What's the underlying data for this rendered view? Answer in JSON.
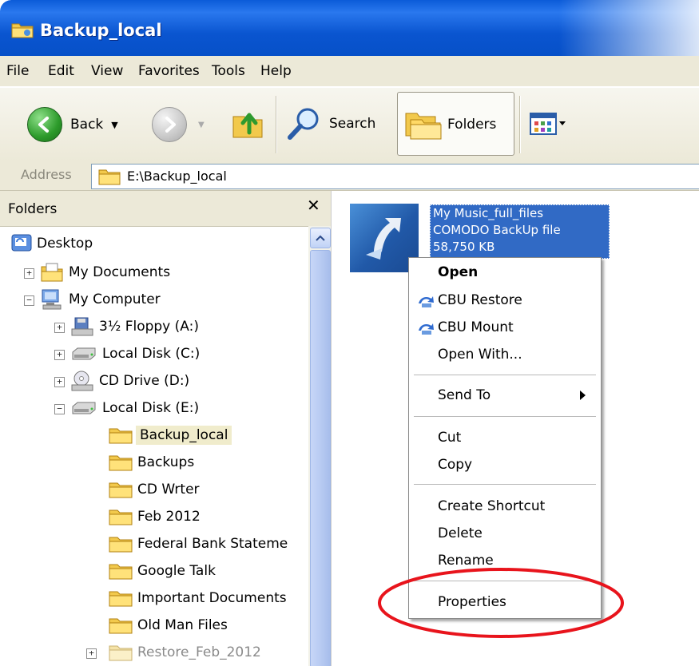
{
  "window": {
    "title": "Backup_local"
  },
  "menubar": {
    "items": [
      "File",
      "Edit",
      "View",
      "Favorites",
      "Tools",
      "Help"
    ]
  },
  "toolbar": {
    "back_label": "Back",
    "search_label": "Search",
    "folders_label": "Folders"
  },
  "address": {
    "label": "Address",
    "value": "E:\\Backup_local"
  },
  "folders_pane": {
    "title": "Folders",
    "close_glyph": "✕",
    "tree": [
      {
        "label": "Desktop"
      },
      {
        "label": "My Documents"
      },
      {
        "label": "My Computer"
      },
      {
        "label": "3½ Floppy (A:)"
      },
      {
        "label": "Local Disk (C:)"
      },
      {
        "label": "CD Drive (D:)"
      },
      {
        "label": "Local Disk (E:)"
      },
      {
        "label": "Backup_local",
        "selected": true
      },
      {
        "label": "Backups"
      },
      {
        "label": "CD Wrter"
      },
      {
        "label": "Feb 2012"
      },
      {
        "label": "Federal Bank Stateme"
      },
      {
        "label": "Google Talk"
      },
      {
        "label": "Important Documents"
      },
      {
        "label": "Old Man Files"
      },
      {
        "label": "Restore_Feb_2012"
      }
    ]
  },
  "file": {
    "name": "My Music_full_files",
    "type": "COMODO BackUp file",
    "size": "58,750 KB"
  },
  "context_menu": {
    "items": [
      "Open",
      "CBU Restore",
      "CBU Mount",
      "Open With...",
      "Send To",
      "Cut",
      "Copy",
      "Create Shortcut",
      "Delete",
      "Rename",
      "Properties"
    ]
  },
  "colors": {
    "selection": "#316ac5",
    "highlight_ring": "#e8141c",
    "title_bar": "#0a55d0"
  }
}
